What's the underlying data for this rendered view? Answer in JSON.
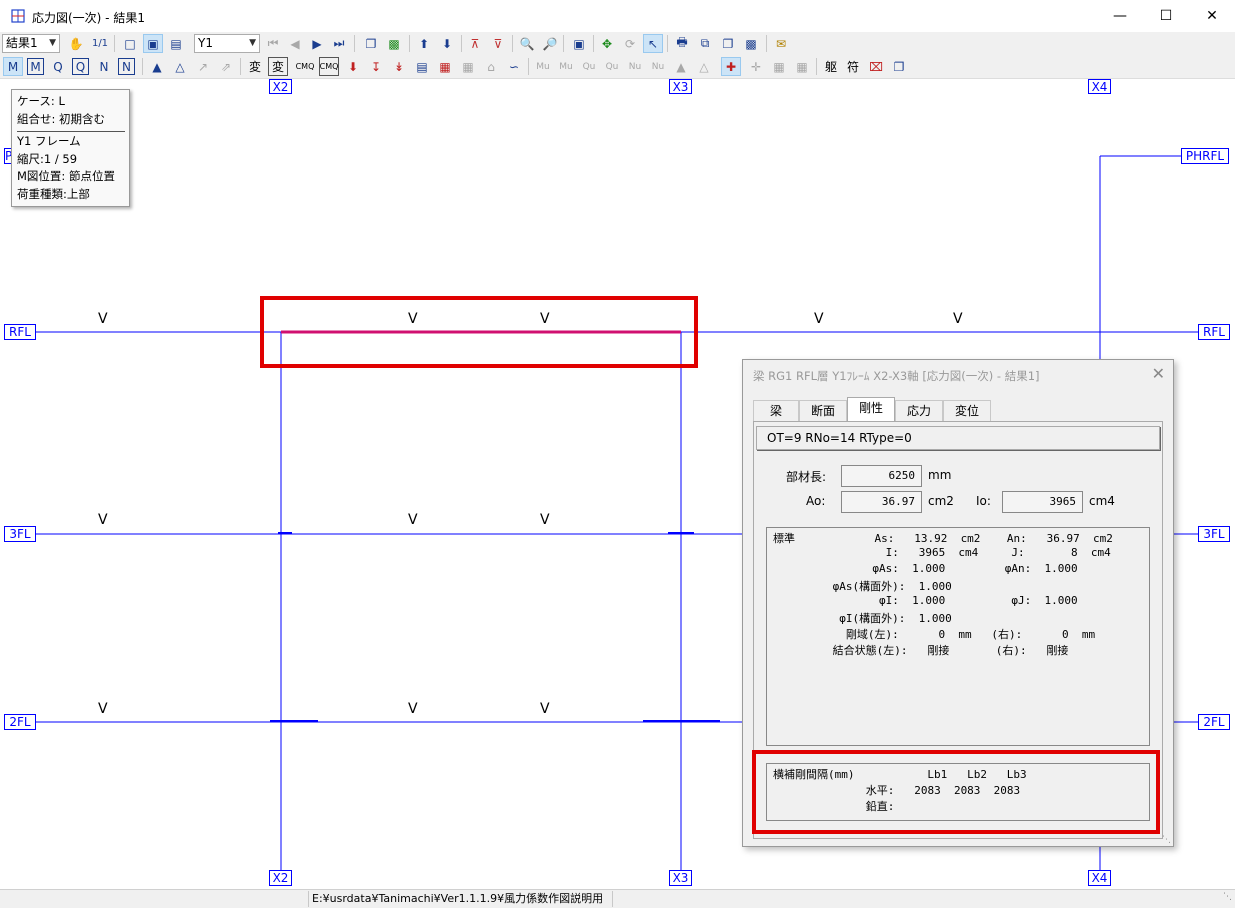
{
  "window": {
    "title": "応力図(一次) - 結果1"
  },
  "toolbar": {
    "result_select": "結果1",
    "frame_select": "Y1",
    "text_1_1": "1/1",
    "label_m": "M",
    "label_q": "Q",
    "label_n": "N",
    "label_hen": "変",
    "label_hen2": "変",
    "label_cmq": "CMQ",
    "label_mu": "Mu",
    "label_qu": "Qu",
    "label_nu": "Nu",
    "label_ku": "躯",
    "label_fu": "符"
  },
  "grid": {
    "axes_top": [
      "X2",
      "X3",
      "X4"
    ],
    "axes_bottom": [
      "X2",
      "X3",
      "X4"
    ],
    "levels": [
      "PHRFL",
      "RFL",
      "3FL",
      "2FL"
    ],
    "level_partial_left": "P",
    "v_mark": "V"
  },
  "infobox": {
    "case": "ケース: L",
    "combo": "組合せ: 初期含む",
    "frame": "Y1 フレーム",
    "scale": "縮尺:1 / 59",
    "mpos": "M図位置: 節点位置",
    "load": "荷重種類:上部"
  },
  "dialog": {
    "title": "梁 RG1 RFL層 Y1ﾌﾚｰﾑ X2-X3軸 [応力図(一次) - 結果1]",
    "tabs": [
      "梁",
      "断面",
      "剛性",
      "応力",
      "変位"
    ],
    "active_tab": "剛性",
    "header": "OT=9 RNo=14 RType=0",
    "member_length_label": "部材長:",
    "member_length": "6250",
    "member_length_unit": "mm",
    "ao_label": "Ao:",
    "ao": "36.97",
    "ao_unit": "cm2",
    "io_label": "Io:",
    "io": "3965",
    "io_unit": "cm4",
    "props": [
      "標準            As:   13.92  cm2    An:   36.97  cm2",
      "                 I:   3965  cm4     J:       8  cm4",
      "               φAs:  1.000         φAn:  1.000",
      "         φAs(構面外):  1.000",
      "                φI:  1.000          φJ:  1.000",
      "          φI(構面外):  1.000",
      "           剛域(左):      0  mm   (右):      0  mm",
      "         結合状態(左):   剛接       (右):   剛接"
    ],
    "lateral": [
      "横補剛間隔(mm)           Lb1   Lb2   Lb3",
      "              水平:   2083  2083  2083",
      "              鉛直:"
    ]
  },
  "status": {
    "path": "E:¥usrdata¥Tanimachi¥Ver1.1.1.9¥風力係数作図説明用"
  },
  "colors": {
    "frame": "#0000ff",
    "highlight": "#e00000",
    "beam_selected": "#d01070"
  }
}
